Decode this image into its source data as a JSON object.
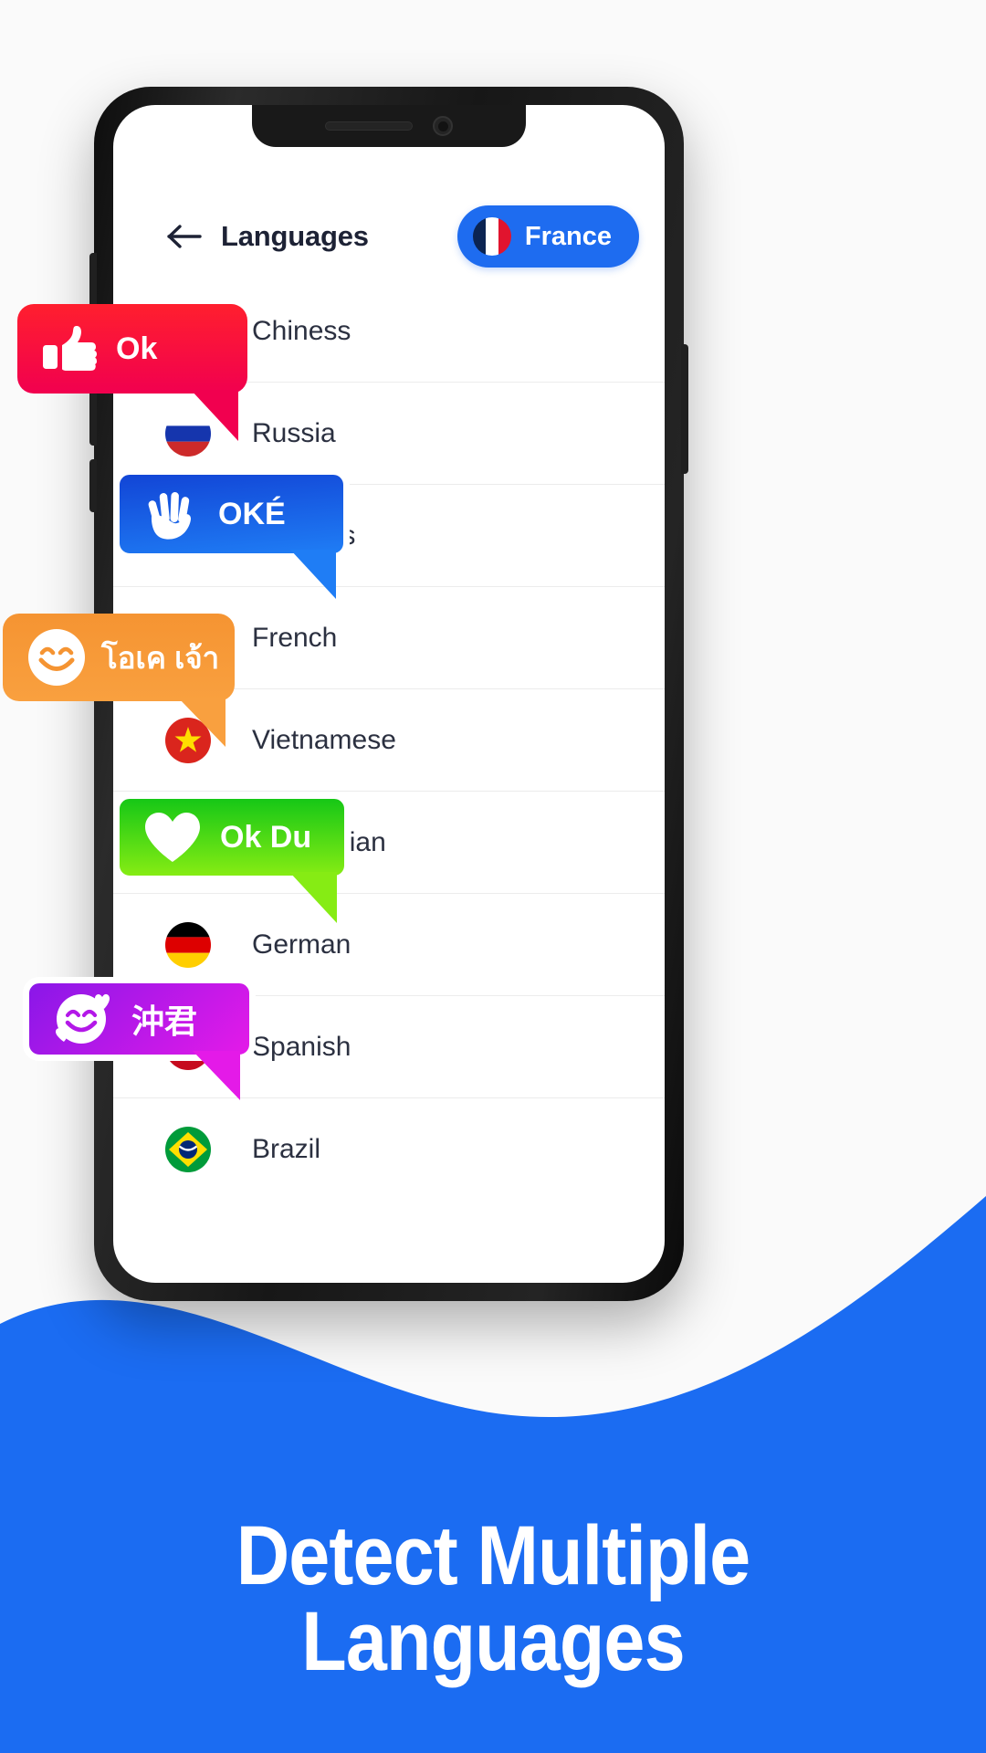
{
  "theme": {
    "accent": "#1e6cf0",
    "background": "#fafafa",
    "screen_bg": "#ffffff",
    "title_color": "#1d2235",
    "divider": "#ececec"
  },
  "phone": {
    "notch": {
      "speaker": "earpiece-speaker",
      "camera": "front-camera"
    },
    "buttons": [
      "volume-up",
      "volume-down",
      "mute-switch",
      "power"
    ]
  },
  "app": {
    "appbar": {
      "back_icon": "arrow-left-icon",
      "title": "Languages",
      "country_pill": {
        "label": "France",
        "flag": "flag-france",
        "background": "#1e6cf0"
      }
    },
    "languages": [
      {
        "name": "Chiness",
        "flag": "flag-china"
      },
      {
        "name": "Russia",
        "flag": "flag-russia"
      },
      {
        "name": "Japanes",
        "flag": "flag-japan"
      },
      {
        "name": "French",
        "flag": "flag-france"
      },
      {
        "name": "Vietnamese",
        "flag": "flag-vietnam"
      },
      {
        "name": "Indonesian",
        "flag": "flag-indonesia"
      },
      {
        "name": "German",
        "flag": "flag-germany"
      },
      {
        "name": "Spanish",
        "flag": "flag-spain"
      },
      {
        "name": "Brazil",
        "flag": "flag-brazil"
      }
    ]
  },
  "bubbles": [
    {
      "id": "ok",
      "text": "Ok",
      "icon": "thumbs-up-icon",
      "color_start": "#ff1f2e",
      "color_end": "#f1004f",
      "outlined": false
    },
    {
      "id": "oke",
      "text": "OKÉ",
      "icon": "open-hand-icon",
      "color_start": "#1245d6",
      "color_end": "#1f7df5",
      "outlined": true
    },
    {
      "id": "thai",
      "text": "โอเค เจ้า",
      "icon": "smiley-face-icon",
      "color_start": "#f59432",
      "color_end": "#f9a03f",
      "outlined": false
    },
    {
      "id": "okdu",
      "text": "Ok Du",
      "icon": "heart-icon",
      "color_start": "#16c716",
      "color_end": "#86ec14",
      "outlined": true
    },
    {
      "id": "cn",
      "text": "沖君",
      "icon": "smiling-hearts-icon",
      "color_start": "#8a17e8",
      "color_end": "#e41ae8",
      "outlined": true
    }
  ],
  "headline": {
    "line1": "Detect Multiple",
    "line2": "Languages",
    "color": "#ffffff",
    "band_color": "#1b6cf2"
  }
}
